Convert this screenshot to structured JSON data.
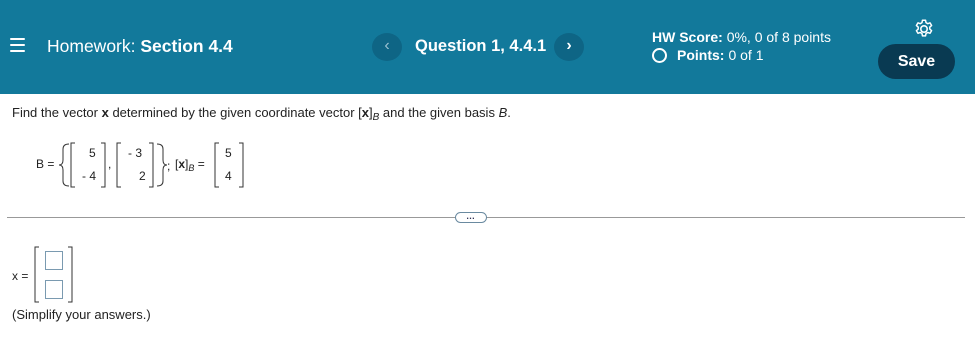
{
  "header": {
    "title_prefix": "Homework:",
    "title_section": "Section 4.4",
    "question_label": "Question 1, 4.4.1",
    "prev_symbol": "‹",
    "next_symbol": "›",
    "hw_score_label": "HW Score:",
    "hw_score_value": "0%, 0 of 8 points",
    "points_label": "Points:",
    "points_value": "0 of 1",
    "save_label": "Save"
  },
  "colors": {
    "header_bg": "#12799b",
    "save_bg": "#093a52",
    "nav_bg": "#0e6585"
  },
  "question": {
    "prompt_part1": "Find the vector ",
    "prompt_var": "x",
    "prompt_part2": " determined by the given coordinate vector ",
    "prompt_coord_bracket_open": "[",
    "prompt_coord_var": "x",
    "prompt_coord_bracket_close": "]",
    "prompt_coord_sub": "B",
    "prompt_part3": " and the given basis ",
    "prompt_basis": "B",
    "prompt_end": ".",
    "basis_label": "B =",
    "basis_vectors": [
      [
        "5",
        "- 4"
      ],
      [
        "- 3",
        "2"
      ]
    ],
    "separator_comma": ",",
    "basis_close_sep": ";",
    "coord_label_open": "[",
    "coord_label_var": "x",
    "coord_label_close": "]",
    "coord_label_sub": "B",
    "coord_label_eq": "=",
    "coord_vector": [
      "5",
      "4"
    ]
  },
  "answer": {
    "label": "x =",
    "box_count": 2,
    "hint": "(Simplify your answers.)"
  },
  "icons": {
    "menu": "hamburger-menu-icon",
    "settings": "gear-icon",
    "expand": "ellipsis-icon",
    "points_status": "circle-outline-icon"
  }
}
